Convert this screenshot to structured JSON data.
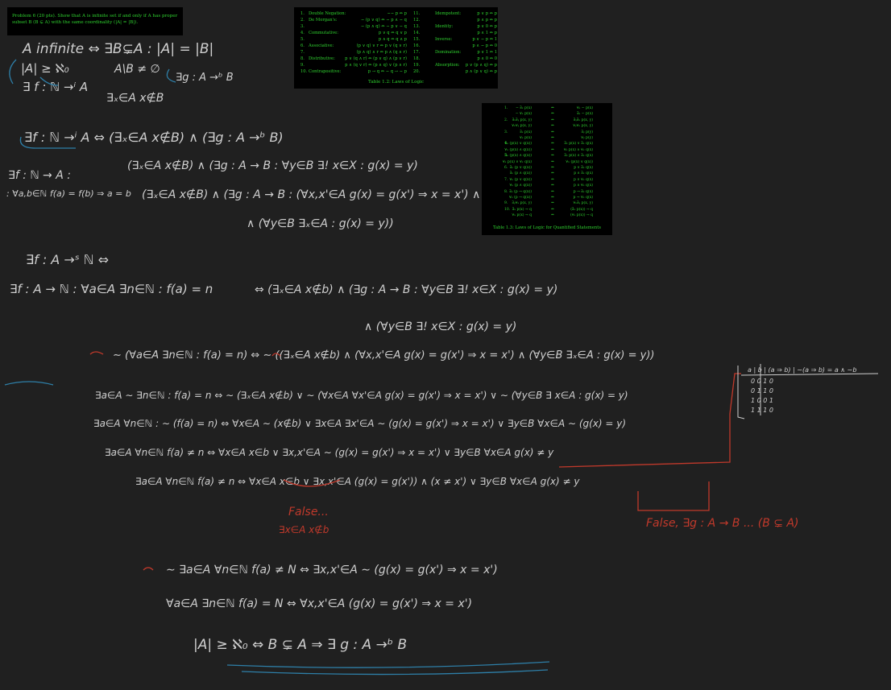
{
  "problem": {
    "line1": "Problem 6 (20 pts). Show that A is infinite set if and only if A has proper",
    "line2": "subset B (B ⊊ A) with the same coordinality (|A| = |B|)."
  },
  "logic_table": {
    "rows": [
      [
        "1.",
        "Double Negation:",
        "∼∼ p ⇔ p",
        "11.",
        "Idempotent:",
        "p ∨ p ⇔ p"
      ],
      [
        "2.",
        "De Morgan's:",
        "∼ (p ∨ q) ⇔ ∼ p ∧ ∼ q",
        "12.",
        "",
        "p ∧ p ⇔ p"
      ],
      [
        "3.",
        "",
        "∼ (p ∧ q) ⇔ ∼ p ∨ ∼ q",
        "13.",
        "Identity:",
        "p ∨ 0 ⇔ p"
      ],
      [
        "4.",
        "Commutative:",
        "p ∨ q ⇔ q ∨ p",
        "14.",
        "",
        "p ∧ 1 ⇔ p"
      ],
      [
        "5.",
        "",
        "p ∧ q ⇔ q ∧ p",
        "15.",
        "Inverse:",
        "p ∨ ∼ p ⇔ 1"
      ],
      [
        "6.",
        "Associative:",
        "(p ∨ q) ∨ r ⇔ p ∨ (q ∨ r)",
        "16.",
        "",
        "p ∧ ∼ p ⇔ 0"
      ],
      [
        "7.",
        "",
        "(p ∧ q) ∧ r ⇔ p ∧ (q ∧ r)",
        "17.",
        "Domination:",
        "p ∨ 1 ⇔ 1"
      ],
      [
        "8.",
        "Distributive:",
        "p ∨ (q ∧ r) ⇔ (p ∨ q) ∧ (p ∨ r)",
        "18.",
        "",
        "p ∧ 0 ⇔ 0"
      ],
      [
        "9.",
        "",
        "p ∧ (q ∨ r) ⇔ (p ∧ q) ∨ (p ∧ r)",
        "19.",
        "Absorption:",
        "p ∨ (p ∧ q) ⇔ p"
      ],
      [
        "10.",
        "Contrapositive:",
        "p → q ⇔ ∼ q → ∼ p",
        "20.",
        "",
        "p ∧ (p ∨ q) ⇔ p"
      ]
    ],
    "caption": "Table 1.2: Laws of Logic"
  },
  "quant_table": {
    "rows": [
      [
        "1.",
        "∼ ∃ₓ p(x)",
        "⇔",
        "∀ₓ ∼ p(x)"
      ],
      [
        "",
        "∼ ∀ₓ p(x)",
        "⇔",
        "∃ₓ ∼ p(x)"
      ],
      [
        "2.",
        "∃ₓ∃ᵧ p(x, y)",
        "⇔",
        "∃ᵧ∃ₓ p(x, y)"
      ],
      [
        "",
        "∀ₓ∀ᵧ p(x, y)",
        "⇔",
        "∀ᵧ∀ₓ p(x, y)"
      ],
      [
        "3.",
        "∃ₓ p(x)",
        "⇔",
        "∃ᵧ p(y)"
      ],
      [
        "",
        "∀ₓ p(x)",
        "⇔",
        "∀ᵧ p(y)"
      ],
      [
        "4.",
        "∃ₓ (p(x) ∨ q(x))",
        "⇔",
        "∃ₓ p(x) ∨ ∃ₓ q(x)"
      ],
      [
        "",
        "∀ₓ (p(x) ∧ q(x))",
        "⇔",
        "∀ₓ p(x) ∧ ∀ₓ q(x)"
      ],
      [
        "5.",
        "∃ₓ (p(x) ∧ q(x))",
        "⇒",
        "∃ₓ p(x) ∧ ∃ₓ q(x)"
      ],
      [
        "",
        "∀ₓ p(x) ∨ ∀ₓ q(x)",
        "⇒",
        "∀ₓ (p(x) ∨ q(x))"
      ],
      [
        "6.",
        "∃ₓ (p ∨ q(x))",
        "⇔",
        "p ∨ ∃ₓ q(x)"
      ],
      [
        "",
        "∃ₓ (p ∧ q(x))",
        "⇔",
        "p ∧ ∃ₓ q(x)"
      ],
      [
        "7.",
        "∀ₓ (p ∨ q(x))",
        "⇔",
        "p ∨ ∀ₓ q(x)"
      ],
      [
        "",
        "∀ₓ (p ∧ q(x))",
        "⇔",
        "p ∧ ∀ₓ q(x)"
      ],
      [
        "8.",
        "∃ₓ (p → q(x))",
        "⇔",
        "p → ∃ₓ q(x)"
      ],
      [
        "",
        "∀ₓ (p → q(x))",
        "⇔",
        "p → ∀ₓ q(x)"
      ],
      [
        "9.",
        "∃ᵧ∀ₓ p(x, y)",
        "⇒",
        "∀ₓ∃ᵧ p(x, y)"
      ],
      [
        "10.",
        "∃ₓ p(x) → q",
        "⇔",
        "(∃ₓ p(x)) → q"
      ],
      [
        "",
        "∀ₓ p(x) → q",
        "⇔",
        "(∀ₓ p(x)) → q"
      ]
    ],
    "caption": "Table 1.3: Laws of Logic for Quantified Statements"
  },
  "handwriting": {
    "l01": "A infinite ⇔ ∃B⊊A : |A| = |B|",
    "l02": "|A| ≥ ℵ₀",
    "l03": "A\\B ≠ ∅",
    "l04": "∃g : A →ᵇ B",
    "l05": "∃ f : ℕ →ⁱ A",
    "l06": "∃ₓ∈A x∉B",
    "l07": "∃f : ℕ →ⁱ A  ⇔  (∃ₓ∈A x∉B) ∧ (∃g : A →ᵇ B)",
    "l08": "(∃ₓ∈A x∉B) ∧ (∃g : A → B : ∀y∈B ∃! x∈X : g(x) = y)",
    "l09": "∃f : ℕ → A :",
    "l10": ": ∀a,b∈ℕ f(a) = f(b) ⇒ a = b",
    "l11": "(∃ₓ∈A x∉B) ∧ (∃g : A → B : (∀x,x'∈A g(x) = g(x') ⇒ x = x') ∧",
    "l12": "∧ (∀y∈B ∃ₓ∈A : g(x) = y))",
    "l13": "∃f : A →ˢ ℕ  ⇔",
    "l14": "∃f : A → ℕ : ∀a∈A ∃n∈ℕ : f(a) = n",
    "l15": "⇔  (∃ₓ∈A x∉b) ∧ (∃g : A → B : ∀y∈B ∃! x∈X : g(x) = y)",
    "l16": "∧ (∀y∈B ∃! x∈X : g(x) = y)",
    "l17": "∼ (∀a∈A ∃n∈ℕ : f(a) = n) ⇔ ∼ ((∃ₓ∈A x∉b) ∧ (∀x,x'∈A g(x) = g(x') ⇒ x = x') ∧ (∀y∈B ∃ₓ∈A : g(x) = y))",
    "l18": "∃a∈A ∼ ∃n∈ℕ : f(a) = n  ⇔  ∼ (∃ₓ∈A x∉b) ∨ ∼ (∀x∈A ∀x'∈A g(x) = g(x') ⇒ x = x') ∨ ∼ (∀y∈B ∃ x∈A : g(x) = y)",
    "l19": "∃a∈A ∀n∈ℕ : ∼ (f(a) = n)  ⇔  ∀x∈A ∼ (x∉b) ∨ ∃x∈A ∃x'∈A ∼ (g(x) = g(x') ⇒ x = x') ∨ ∃y∈B ∀x∈A ∼ (g(x) = y)",
    "l20": "∃a∈A ∀n∈ℕ f(a) ≠ n  ⇔  ∀x∈A x∈b ∨ ∃x,x'∈A ∼ (g(x) = g(x') ⇒ x = x') ∨ ∃y∈B ∀x∈A g(x) ≠ y",
    "l21": "∃a∈A ∀n∈ℕ f(a) ≠ n  ⇔  ∀x∈A x∈b ∨ ∃x,x'∈A (g(x) = g(x')) ∧ (x ≠ x') ∨ ∃y∈B ∀x∈A g(x) ≠ y",
    "l22": "False...",
    "l23": "∃x∈A x∉b",
    "l24": "False, ∃g : A → B ... (B ⊊ A)",
    "l25": "∼ ∃a∈A ∀n∈ℕ f(a) ≠ N ⇔ ∃x,x'∈A ∼ (g(x) = g(x') ⇒ x = x')",
    "l26": "∀a∈A ∃n∈ℕ f(a) = N ⇔ ∀x,x'∈A (g(x) = g(x') ⇒ x = x')",
    "l27": "|A| ≥ ℵ₀ ⇔ B ⊊ A ⇒ ∃ g : A →ᵇ B",
    "truth_header": "a | b | (a ⇒ b) | ∼(a ⇒ b) = a ∧ ∼b",
    "truth_rows": [
      "0 0   1   0",
      "0 1   1   0",
      "1 0   0   1",
      "1 1   1   0"
    ]
  }
}
